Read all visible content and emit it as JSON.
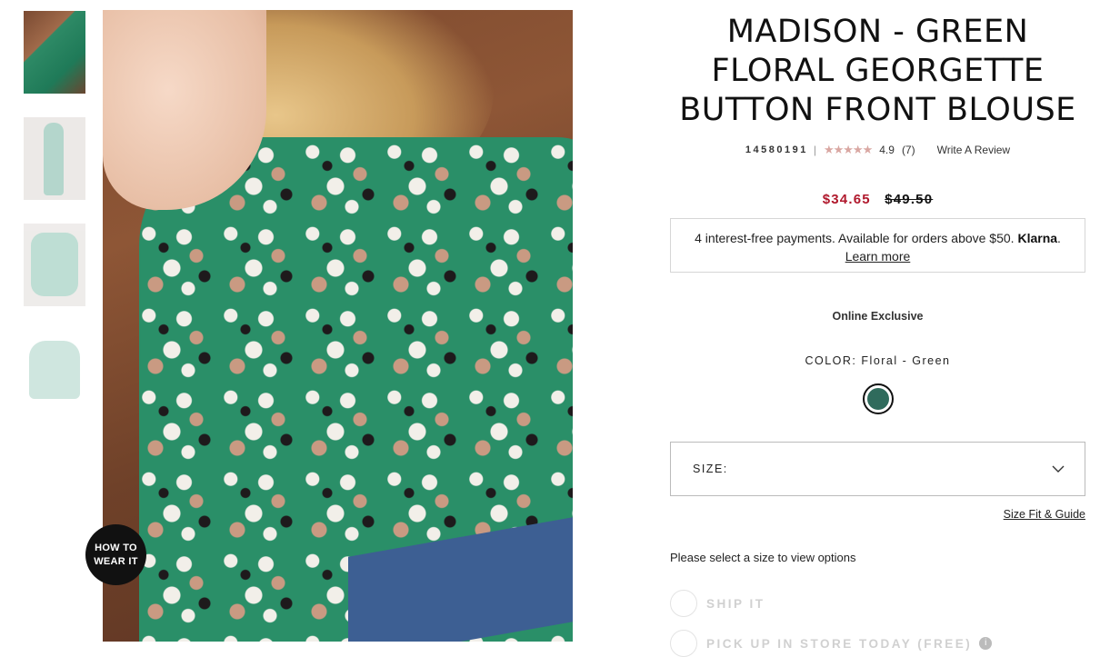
{
  "thumbnails": [
    {
      "alt": "model front"
    },
    {
      "alt": "full outfit"
    },
    {
      "alt": "back detail"
    },
    {
      "alt": "flat lay"
    }
  ],
  "hero": {
    "how_to_line1": "HOW TO",
    "how_to_line2": "WEAR IT",
    "zoom_icon": "expand-icon"
  },
  "product": {
    "title_line1": "MADISON - GREEN",
    "title_line2": "FLORAL GEORGETTE",
    "title_line3": "BUTTON FRONT BLOUSE",
    "sku": "14580191",
    "separator": "|",
    "stars": "★★★★★",
    "rating": "4.9",
    "review_count": "(7)",
    "write_review": "Write A Review",
    "sale_price": "$34.65",
    "original_price": "$49.50"
  },
  "klarna": {
    "text": "4 interest-free payments. Available for orders above $50.",
    "brand": "Klarna",
    "period": ".",
    "learn_more": "Learn more"
  },
  "badge": "Online Exclusive",
  "color": {
    "label": "COLOR:",
    "value": "Floral - Green",
    "swatch_hex": "#2f6b5c"
  },
  "size": {
    "label": "SIZE:",
    "guide_link": "Size Fit & Guide",
    "prompt": "Please select a size to view options"
  },
  "fulfillment": {
    "ship_label": "SHIP IT",
    "pickup_label": "PICK UP IN STORE TODAY (FREE)"
  },
  "colors": {
    "sale": "#b0182c",
    "stars": "#d9a7a2"
  }
}
